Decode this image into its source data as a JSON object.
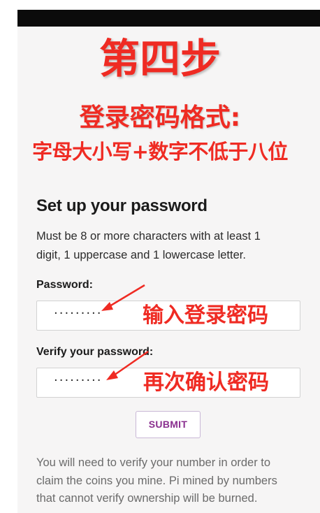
{
  "annotations": {
    "step_title": "第四步",
    "format_title": "登录密码格式:",
    "format_rule": "字母大小写+数字不低于八位",
    "password_hint": "输入登录密码",
    "verify_hint": "再次确认密码",
    "color": "#ef2b23"
  },
  "form": {
    "heading": "Set up your password",
    "description": "Must be 8 or more characters with at least 1 digit, 1 uppercase and 1 lowercase letter.",
    "password_label": "Password:",
    "password_value": "·········",
    "verify_label": "Verify your password:",
    "verify_value": "·········",
    "submit_label": "SUBMIT"
  },
  "footer": {
    "text": "You will need to verify your number in order to claim the coins you mine. Pi mined by numbers that cannot verify ownership will be burned."
  },
  "colors": {
    "accent": "#8a2f8f",
    "annotation": "#ef2b23",
    "background": "#f6f5f5"
  }
}
